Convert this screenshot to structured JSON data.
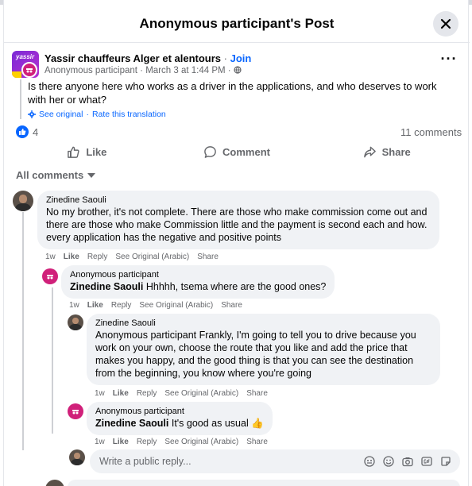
{
  "modal": {
    "title": "Anonymous participant's Post"
  },
  "post": {
    "group_name": "Yassir chauffeurs Alger et alentours",
    "join_label": "Join",
    "separator": " · ",
    "author": "Anonymous participant",
    "date": "March 3 at 1:44 PM",
    "text": "Is there anyone here who works as a driver in the applications, and who deserves to work with her or what?",
    "see_original": "See original",
    "rate_translation": "Rate this translation",
    "group_avatar_text": "yassir",
    "reaction_count": "4",
    "comment_count": "11 comments"
  },
  "actions": {
    "like": "Like",
    "comment": "Comment",
    "share": "Share"
  },
  "filter": {
    "label": "All comments"
  },
  "comments": [
    {
      "author": "Zinedine Saouli",
      "mention": "",
      "text": "No my brother, it's not complete. There are those who make commission come out and there are those who make Commission little and the payment is second each and how. every application has the negative and positive points",
      "time": "1w",
      "like": "Like",
      "reply": "Reply",
      "see_original": "See Original (Arabic)",
      "share": "Share"
    },
    {
      "author": "Anonymous participant",
      "mention": "Zinedine Saouli",
      "text": " Hhhhh, tsema where are the good ones?",
      "time": "1w",
      "like": "Like",
      "reply": "Reply",
      "see_original": "See Original (Arabic)",
      "share": "Share"
    },
    {
      "author": "Zinedine Saouli",
      "mention": "",
      "text": "Anonymous participant Frankly, I'm going to tell you to drive because you work on your own, choose the route that you like and add the price that makes you happy, and the good thing is that you can see the destination from the beginning, you know where you're going",
      "time": "1w",
      "like": "Like",
      "reply": "Reply",
      "see_original": "See Original (Arabic)",
      "share": "Share"
    },
    {
      "author": "Anonymous participant",
      "mention": "Zinedine Saouli",
      "text": " It's good as usual 👍",
      "time": "1w",
      "like": "Like",
      "reply": "Reply",
      "see_original": "See Original (Arabic)",
      "share": "Share"
    }
  ],
  "reply_box": {
    "placeholder": "Write a public reply..."
  },
  "colors": {
    "accent": "#0866ff",
    "anon": "#d0207a",
    "bubble": "#f0f2f5",
    "muted": "#65676b"
  },
  "icons": [
    "close-icon",
    "more-icon",
    "globe-icon",
    "gear-icon",
    "like-icon",
    "comment-icon",
    "share-icon",
    "chevron-down-icon",
    "avatar-sticker-icon",
    "emoji-icon",
    "camera-icon",
    "gif-icon",
    "sticker-icon"
  ]
}
